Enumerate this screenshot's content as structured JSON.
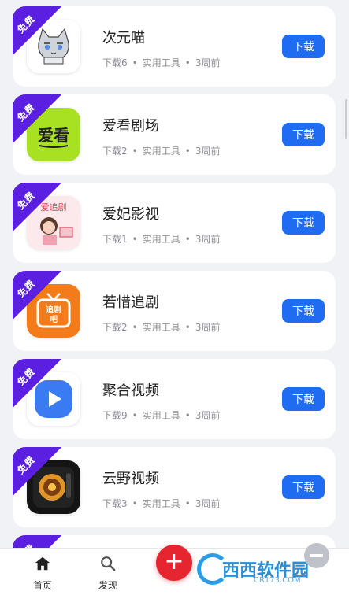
{
  "apps": [
    {
      "badge": "免费",
      "name": "次元喵",
      "downloads": "下载6",
      "category": "实用工具",
      "time": "3周前",
      "button": "下载",
      "icon": "cat-anime-icon"
    },
    {
      "badge": "免费",
      "name": "爱看剧场",
      "downloads": "下载2",
      "category": "实用工具",
      "time": "3周前",
      "button": "下载",
      "icon": "aikan-icon",
      "icon_text": "爱看"
    },
    {
      "badge": "免费",
      "name": "爱妃影视",
      "downloads": "下载1",
      "category": "实用工具",
      "time": "3周前",
      "button": "下载",
      "icon": "aifei-icon",
      "icon_text": "爱追剧"
    },
    {
      "badge": "免费",
      "name": "若惜追剧",
      "downloads": "下载2",
      "category": "实用工具",
      "time": "3周前",
      "button": "下载",
      "icon": "tv-icon",
      "icon_text": "追剧吧"
    },
    {
      "badge": "免费",
      "name": "聚合视频",
      "downloads": "下载9",
      "category": "实用工具",
      "time": "3周前",
      "button": "下载",
      "icon": "play-icon"
    },
    {
      "badge": "免费",
      "name": "云野视频",
      "downloads": "下载3",
      "category": "实用工具",
      "time": "3周前",
      "button": "下载",
      "icon": "camera-icon"
    }
  ],
  "partial_card": {
    "badge": "免费"
  },
  "nav": {
    "home": "首页",
    "discover": "发现",
    "fab": "+"
  },
  "watermark": {
    "brand": "西西软件园",
    "domain": "CR173.COM"
  },
  "colors": {
    "accent": "#1f6cf2",
    "badge": "#5a1fe0",
    "fab": "#e52630"
  }
}
